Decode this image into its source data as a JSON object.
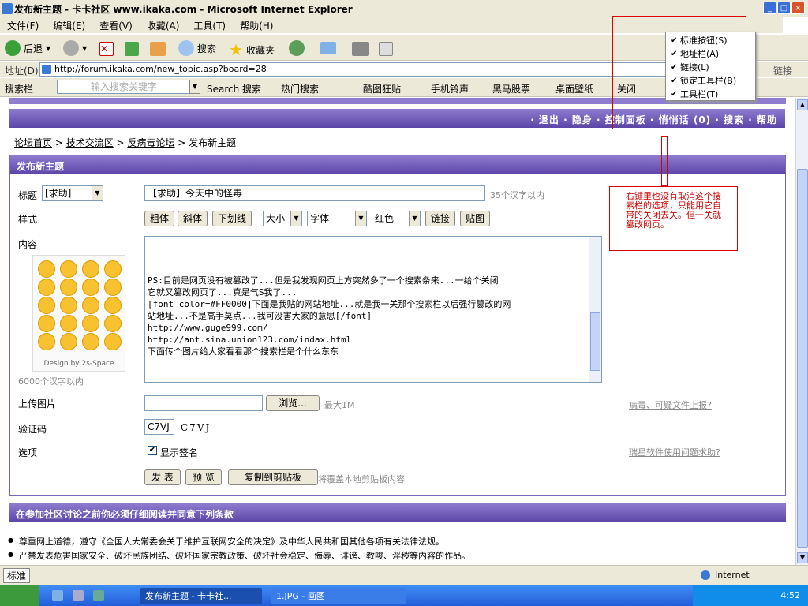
{
  "window": {
    "title": "发布新主题 - 卡卡社区 www.ikaka.com   - Microsoft Internet Explorer"
  },
  "menu": [
    "文件(F)",
    "编辑(E)",
    "查看(V)",
    "收藏(A)",
    "工具(T)",
    "帮助(H)"
  ],
  "toolbar": {
    "back": "后退",
    "search": "搜索",
    "favorites": "收藏夹"
  },
  "address": {
    "label": "地址(D)",
    "url": "http://forum.ikaka.com/new_topic.asp?board=28",
    "links": "链接"
  },
  "searchbar": {
    "label": "搜索栏",
    "placeholder": "输入搜索关键字",
    "items": [
      "Search 搜索",
      "热门搜索",
      "酷图狂贴",
      "手机铃声",
      "黑马股票",
      "桌面壁纸",
      "关闭"
    ]
  },
  "context_menu": [
    "标准按钮(S)",
    "地址栏(A)",
    "链接(L)",
    "锁定工具栏(B)",
    "工具栏(T)"
  ],
  "annotation": "右键里也没有取消这个搜索栏的选项，只能用它自带的关闭去关。但一关就篡改网页。",
  "forum": {
    "nav_links": "· 退出  · 隐身  · 控制面板  · 悄悄话 (0)  · 搜索  · 帮助",
    "breadcrumb": [
      "论坛首页",
      "技术交流区",
      "反病毒论坛",
      "发布新主题"
    ],
    "form_title": "发布新主题",
    "labels": {
      "title": "标题",
      "style": "样式",
      "content": "内容",
      "upload": "上传图片",
      "captcha": "验证码",
      "options": "选项"
    },
    "title_prefix": "[求助]",
    "title_value": "【求助】今天中的怪毒",
    "title_hint": "35个汉字以内",
    "style_buttons": [
      "粗体",
      "斜体",
      "下划线"
    ],
    "size_select": "大小",
    "font_select": "字体",
    "color_select": "红色",
    "link_button": "链接",
    "image_button": "贴图",
    "emoji_caption": "Design by 2s-Space",
    "content_hint": "6000个汉字以内",
    "content_lines": [
      "PS:目前是网页没有被篡改了...但是我发现网页上方突然多了一个搜索条来...一给个关闭",
      "它就又篡改网页了...真是气S我了...",
      "",
      "[font_color=#FF0000]下面是我贴的网站地址...就是我一关那个搜索栏以后强行篡改的网",
      "站地址...不是高手莫点...我可没害大家的意思[/font]",
      "http://www.guge999.com/",
      "",
      "http://ant.sina.union123.com/indax.html",
      "",
      "",
      "下面传个图片给大家看看那个搜索栏是个什么东东"
    ],
    "browse_button": "浏览...",
    "upload_max": "最大1M",
    "captcha_value": "C7VJ",
    "captcha_image_text": "C7VJ",
    "option_show_signature": "显示签名",
    "submit_button": "发 表",
    "preview_button": "预 览",
    "copy_button": "复制到剪贴板",
    "copy_hint": "将覆盖本地剪贴板内容",
    "report_link": "病毒、可疑文件上报?",
    "help_link": "瑞星软件使用问题求助?",
    "rules_title": "在参加社区讨论之前你必须仔细阅读并同意下列条款",
    "rules": [
      "尊重网上道德，遵守《全国人大常委会关于维护互联网安全的决定》及中华人民共和国其他各项有关法律法规。",
      "严禁发表危害国家安全、破坏民族团结、破坏国家宗教政策、破坏社会稳定、侮辱、诽谤、教唆、淫秽等内容的作品。"
    ]
  },
  "status": {
    "ime": "标准",
    "zone": "Internet"
  },
  "taskbar": {
    "tasks": [
      "发布新主题 - 卡卡社...",
      "1.JPG - 画图"
    ],
    "clock": "4:52"
  }
}
